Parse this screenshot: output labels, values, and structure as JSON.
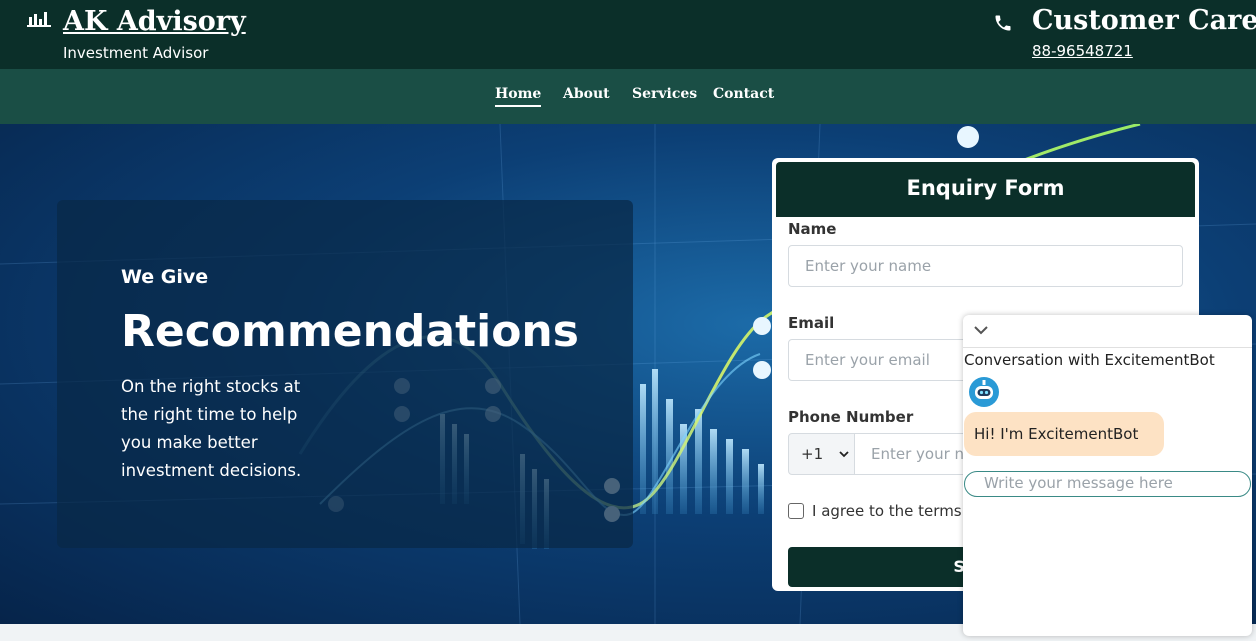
{
  "header": {
    "brand_icon": "bar-chart-icon",
    "brand_title": "AK Advisory",
    "brand_subtitle": "Investment Advisor",
    "care_icon": "phone-icon",
    "care_title": "Customer Care",
    "care_phone": "88-96548721"
  },
  "nav": {
    "items": [
      {
        "label": "Home",
        "active": true
      },
      {
        "label": "About",
        "active": false
      },
      {
        "label": "Services",
        "active": false
      },
      {
        "label": "Contact",
        "active": false
      }
    ]
  },
  "hero": {
    "kicker": "We Give",
    "title": "Recommendations",
    "text": "On the right stocks at the right time to help you make better investment decisions."
  },
  "enquiry_form": {
    "title": "Enquiry Form",
    "name_label": "Name",
    "name_placeholder": "Enter your name",
    "email_label": "Email",
    "email_placeholder": "Enter your email",
    "phone_label": "Phone Number",
    "country_code": "+1",
    "phone_placeholder": "Enter your number",
    "terms_label": "I agree to the terms and conditions",
    "submit_label": "Submit"
  },
  "chatbot": {
    "collapse_icon": "chevron-down-icon",
    "title": "Conversation with ExcitementBot",
    "avatar_icon": "robot-icon",
    "greeting": "Hi! I'm ExcitementBot",
    "input_placeholder": "Write your message here"
  },
  "colors": {
    "header_bg": "#0b2f29",
    "nav_bg": "#1a4e45",
    "bubble_bg": "#fde2c4",
    "accent": "#3a8a86"
  }
}
